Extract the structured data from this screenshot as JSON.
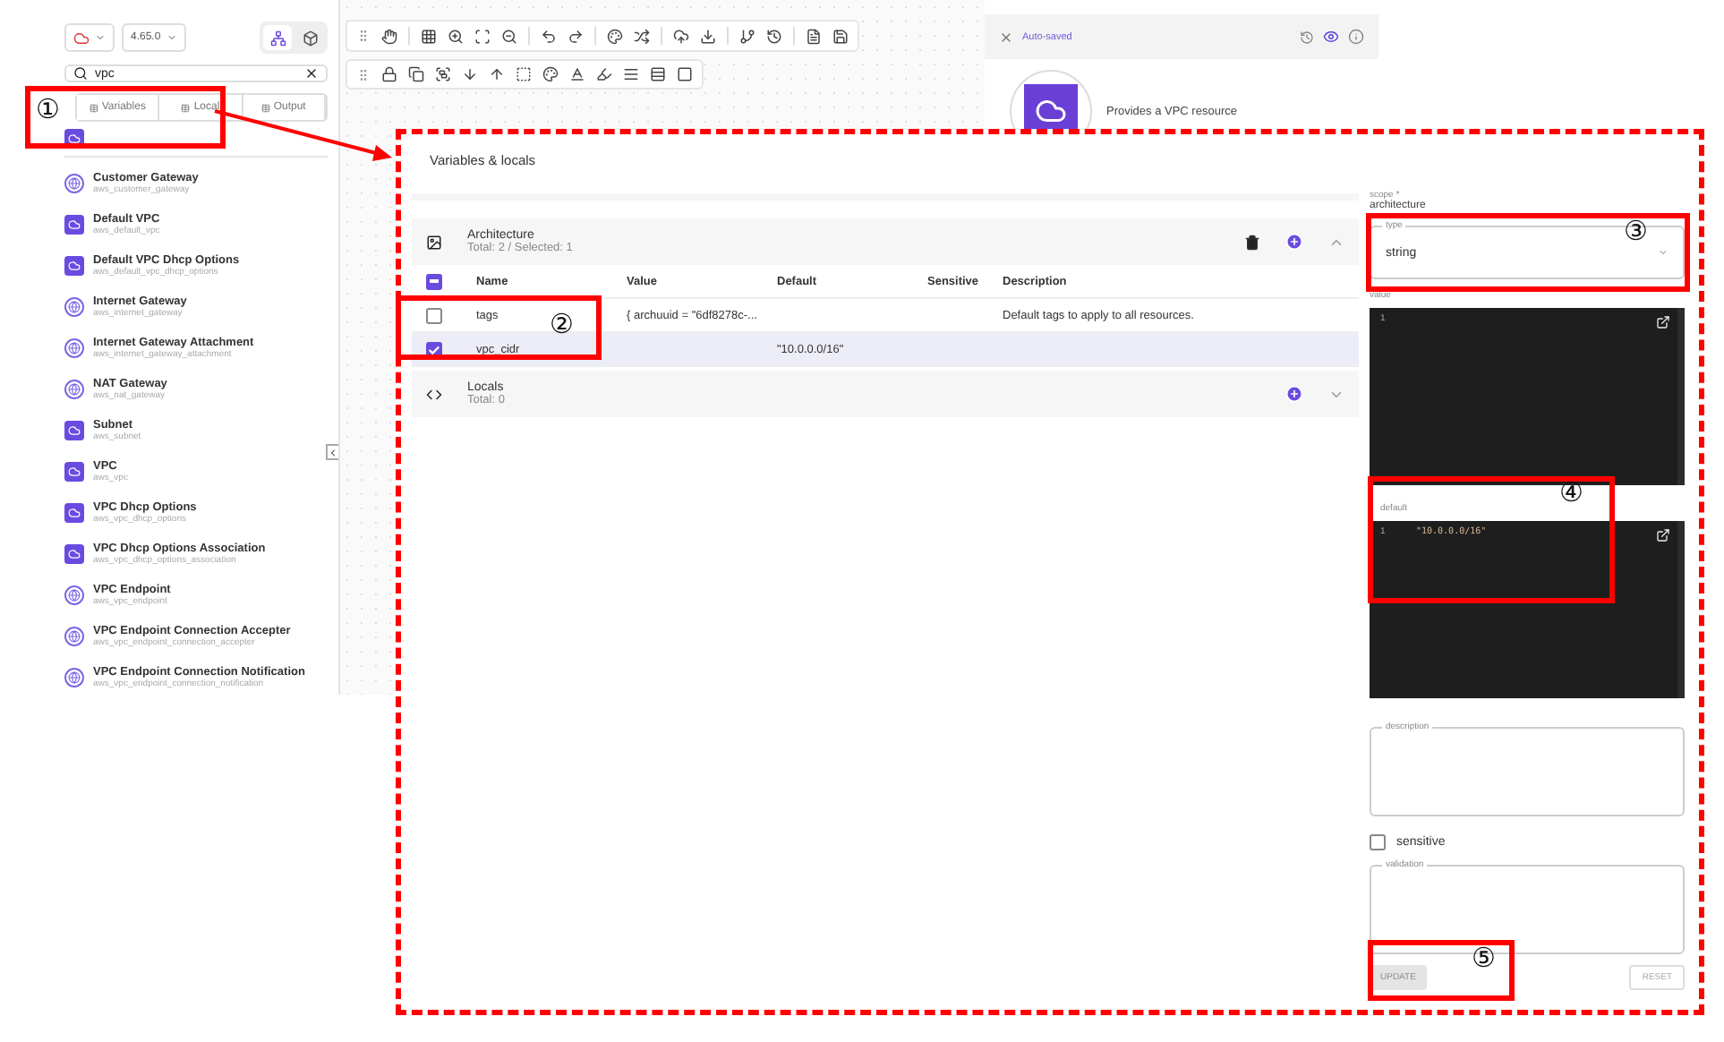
{
  "sidebar": {
    "version": "4.65.0",
    "search": "vpc",
    "tabs": [
      {
        "label": "Variables",
        "selected": false
      },
      {
        "label": "Local",
        "selected": false
      },
      {
        "label": "Output",
        "selected": false
      }
    ],
    "items": [
      {
        "name": "Customer Gateway",
        "resource": "aws_customer_gateway",
        "kind": "outline"
      },
      {
        "name": "Default VPC",
        "resource": "aws_default_vpc",
        "kind": "badge"
      },
      {
        "name": "Default VPC Dhcp Options",
        "resource": "aws_default_vpc_dhcp_options",
        "kind": "badge"
      },
      {
        "name": "Internet Gateway",
        "resource": "aws_internet_gateway",
        "kind": "outline"
      },
      {
        "name": "Internet Gateway Attachment",
        "resource": "aws_internet_gateway_attachment",
        "kind": "outline"
      },
      {
        "name": "NAT Gateway",
        "resource": "aws_nat_gateway",
        "kind": "outline"
      },
      {
        "name": "Subnet",
        "resource": "aws_subnet",
        "kind": "badge"
      },
      {
        "name": "VPC",
        "resource": "aws_vpc",
        "kind": "badge"
      },
      {
        "name": "VPC Dhcp Options",
        "resource": "aws_vpc_dhcp_options",
        "kind": "badge"
      },
      {
        "name": "VPC Dhcp Options Association",
        "resource": "aws_vpc_dhcp_options_association",
        "kind": "badge"
      },
      {
        "name": "VPC Endpoint",
        "resource": "aws_vpc_endpoint",
        "kind": "outline"
      },
      {
        "name": "VPC Endpoint Connection Accepter",
        "resource": "aws_vpc_endpoint_connection_accepter",
        "kind": "outline"
      },
      {
        "name": "VPC Endpoint Connection Notification",
        "resource": "aws_vpc_endpoint_connection_notification",
        "kind": "outline"
      }
    ]
  },
  "details_panel": {
    "status": "Auto-saved",
    "description": "Provides a VPC resource"
  },
  "variables_dialog": {
    "title": "Variables & locals",
    "groups": [
      {
        "name": "Architecture",
        "summary": "Total: 2 / Selected: 1",
        "expanded": true,
        "indeterminate": true,
        "columns": [
          "Name",
          "Value",
          "Default",
          "Sensitive",
          "Description"
        ],
        "rows": [
          {
            "name": "tags",
            "value": "{ archuuid = \"6df8278c-...",
            "default": "",
            "description": "Default tags to apply to all resources.",
            "selected": false
          },
          {
            "name": "vpc_cidr",
            "value": "",
            "default": "\"10.0.0.0/16\"",
            "description": "",
            "selected": true
          }
        ]
      },
      {
        "name": "Locals",
        "summary": "Total: 0",
        "expanded": false
      }
    ],
    "form": {
      "scope_label": "scope *",
      "scope_value": "architecture",
      "type_label": "type",
      "type_value": "string",
      "value_label": "value",
      "value_lines": [
        {
          "number": "1"
        }
      ],
      "default_label": "default",
      "default_lines": [
        {
          "number": "1",
          "code": "\"10.0.0.0/16\""
        }
      ],
      "description_label": "description",
      "sensitive": {
        "label": "sensitive",
        "checked": false
      },
      "validation_label": "validation",
      "update": {
        "label": "UPDATE",
        "disabled": true
      },
      "reset": {
        "label": "RESET"
      }
    }
  },
  "annotations": [
    {
      "number": "①"
    },
    {
      "number": "②"
    },
    {
      "number": "③"
    },
    {
      "number": "④"
    },
    {
      "number": "⑤"
    }
  ]
}
